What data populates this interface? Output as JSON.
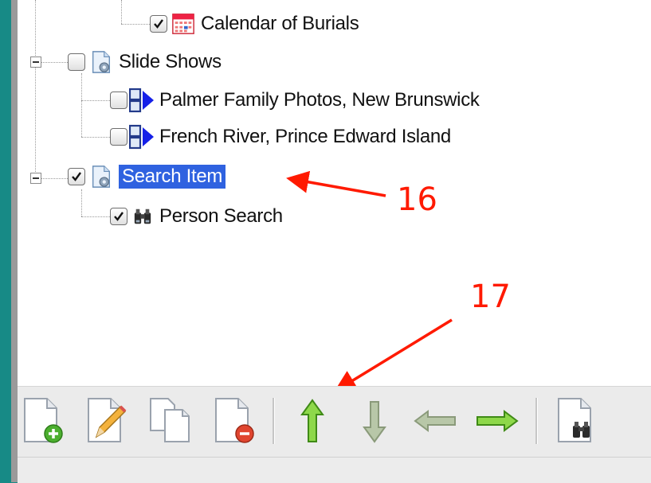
{
  "tree": {
    "items": [
      {
        "label": "Calendar of Burials",
        "checked": true,
        "icon": "calendar-icon"
      },
      {
        "label": "Slide Shows",
        "checked": false,
        "icon": "gear-page-icon",
        "expanded": true
      },
      {
        "label": "Palmer Family Photos, New Brunswick",
        "checked": false,
        "icon": "slideshow-icon"
      },
      {
        "label": "French River, Prince Edward Island",
        "checked": false,
        "icon": "slideshow-icon"
      },
      {
        "label": "Search Item",
        "checked": true,
        "icon": "gear-page-icon",
        "expanded": true,
        "selected": true
      },
      {
        "label": "Person Search",
        "checked": true,
        "icon": "binoculars-icon"
      }
    ]
  },
  "annotations": {
    "a16": "16",
    "a17": "17"
  },
  "toolbar": {
    "buttons": [
      "new-item",
      "edit-item",
      "copy-item",
      "delete-item",
      "move-up",
      "move-down",
      "move-left",
      "move-right",
      "search"
    ]
  },
  "colors": {
    "selection": "#2f62e0",
    "annotation": "#ff1a00",
    "background": "#178a86"
  }
}
